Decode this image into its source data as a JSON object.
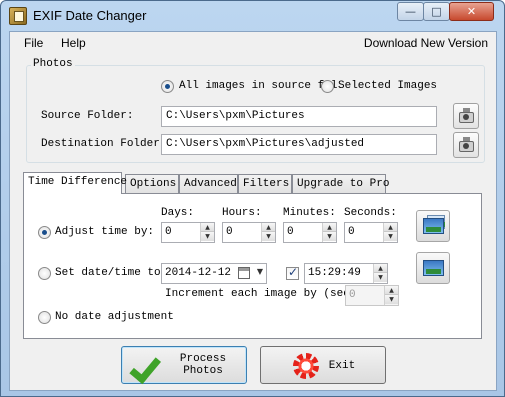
{
  "window": {
    "title": "EXIF Date Changer",
    "controls": {
      "minimize": "—",
      "maximize": "□",
      "close": "✕"
    }
  },
  "menu": {
    "file": "File",
    "help": "Help",
    "download": "Download New Version"
  },
  "photos": {
    "group_title": "Photos",
    "all_images_label": "All images in source fol",
    "selected_images_label": "Selected Images",
    "source_label": "Source Folder:",
    "source_value": "C:\\Users\\pxm\\Pictures",
    "destination_label": "Destination Folder:",
    "destination_value": "C:\\Users\\pxm\\Pictures\\adjusted"
  },
  "tabs": [
    "Time Difference",
    "Options",
    "Advanced",
    "Filters",
    "Upgrade to Pro"
  ],
  "time_difference": {
    "days_label": "Days:",
    "hours_label": "Hours:",
    "minutes_label": "Minutes:",
    "seconds_label": "Seconds:",
    "adjust_label": "Adjust time by:",
    "days": "0",
    "hours": "0",
    "minutes": "0",
    "seconds": "0",
    "set_label": "Set date/time to:",
    "date": "2014-12-12",
    "time": "15:29:49",
    "increment_label": "Increment each image by (secon",
    "increment": "0",
    "no_adjust_label": "No date adjustment"
  },
  "buttons": {
    "process_line1": "Process",
    "process_line2": "Photos",
    "exit": "Exit"
  },
  "icons": {
    "app": "camera-document-icon",
    "browse": "scanner-icon",
    "action": "picture-icon",
    "process": "green-check-icon",
    "exit": "red-burst-icon"
  },
  "colors": {
    "title_bar": "#bcd6f0",
    "check_green": "#3fa329",
    "exit_red": "#e4221a"
  },
  "state": {
    "all_images_selected": true,
    "adjust_selected": true,
    "date_checkbox_checked": true
  }
}
